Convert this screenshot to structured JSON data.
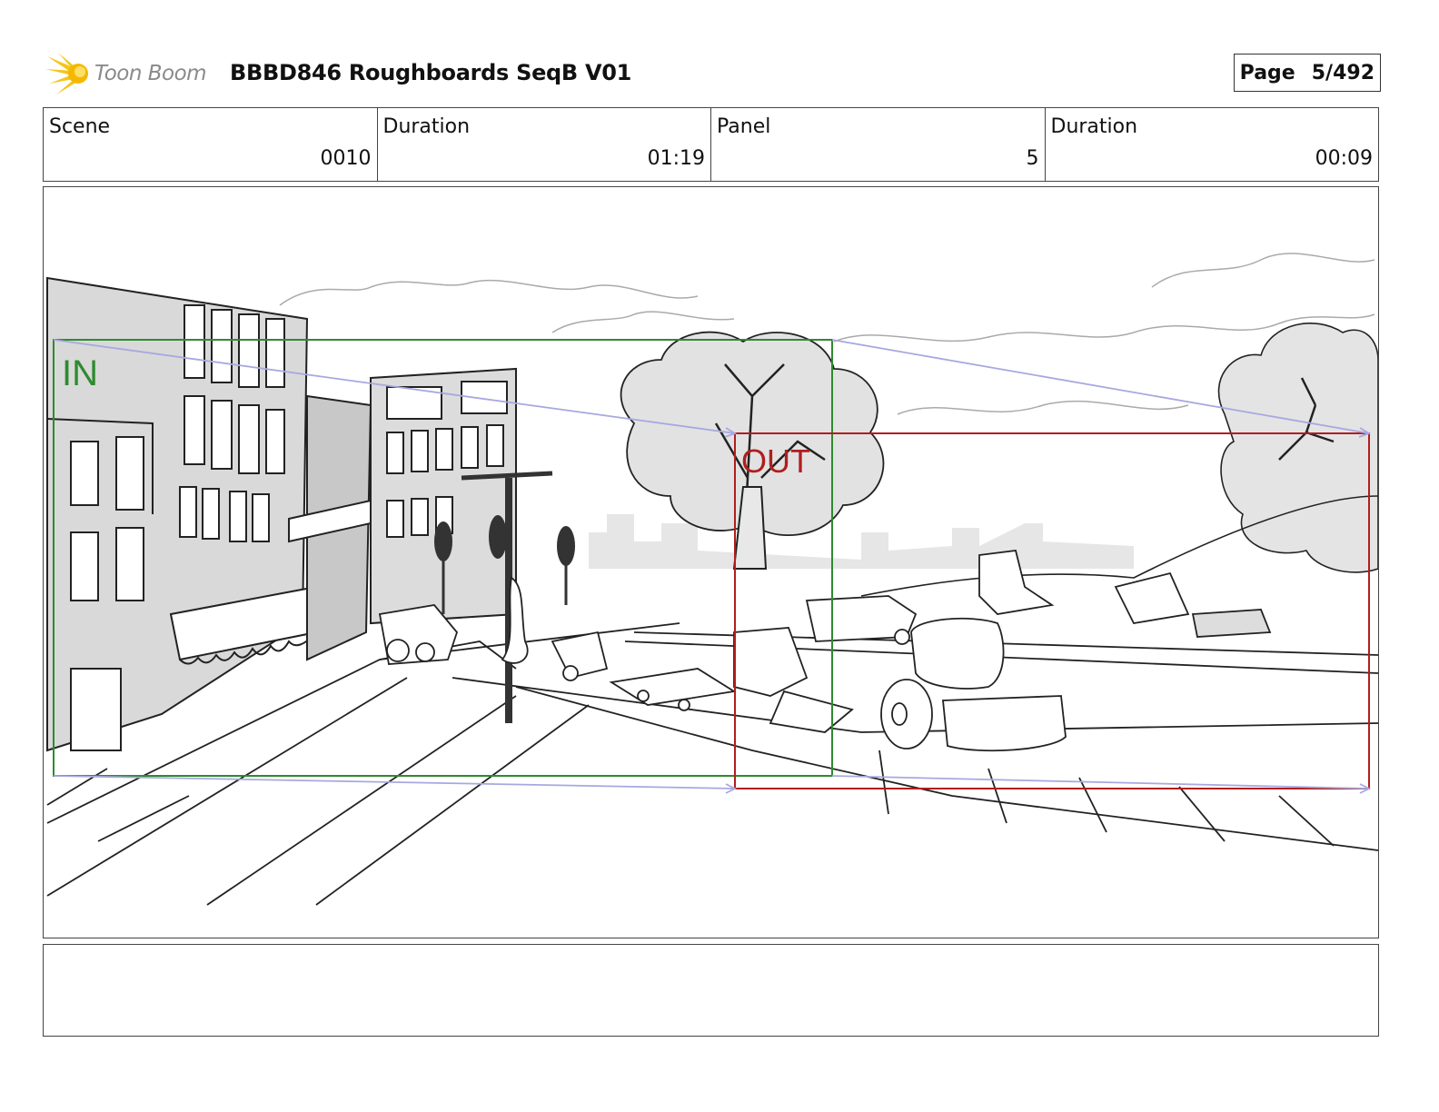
{
  "header": {
    "logo_text": "Toon Boom",
    "title": "BBBD846 Roughboards SeqB V01",
    "page_label": "Page",
    "page_value": "5/492"
  },
  "info": {
    "scene_label": "Scene",
    "scene_value": "0010",
    "duration_label": "Duration",
    "duration_value": "01:19",
    "panel_label": "Panel",
    "panel_value": "5",
    "panel_duration_label": "Duration",
    "panel_duration_value": "00:09"
  },
  "panel": {
    "in_label": "IN",
    "out_label": "OUT",
    "in_color": "#2e8b2e",
    "out_color": "#b01e1e",
    "arrow_color": "#a8a8e0"
  },
  "notes": {
    "text": ""
  }
}
